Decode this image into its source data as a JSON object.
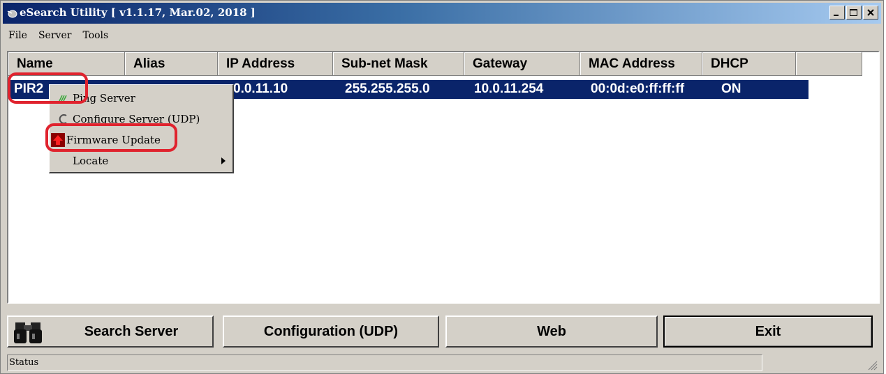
{
  "window": {
    "title": "eSearch Utility [ v1.1.17, Mar.02, 2018 ]",
    "controls": [
      "minimize-icon",
      "maximize-icon",
      "close-icon"
    ]
  },
  "menubar": {
    "items": [
      "File",
      "Server",
      "Tools"
    ]
  },
  "table": {
    "columns": [
      "Name",
      "Alias",
      "IP Address",
      "Sub-net Mask",
      "Gateway",
      "MAC Address",
      "DHCP"
    ],
    "rows": [
      {
        "name": "PIR2",
        "ip": "0.0.11.10",
        "mask": "255.255.255.0",
        "gateway": "10.0.11.254",
        "mac": "00:0d:e0:ff:ff:ff",
        "dhcp": "ON",
        "selected": true
      }
    ]
  },
  "context_menu": {
    "items": [
      {
        "label": "Ping Server",
        "icon": "ping-icon"
      },
      {
        "label": "Configure Server (UDP)",
        "icon": "configure-icon"
      },
      {
        "label": "Firmware Update",
        "icon": "firmware-update-icon"
      },
      {
        "label": "Locate",
        "icon": "submenu-arrow-icon"
      }
    ]
  },
  "buttons": {
    "search": "Search Server",
    "configuration": "Configuration (UDP)",
    "web": "Web",
    "exit": "Exit"
  },
  "status": {
    "text": "Status"
  },
  "colors": {
    "selection": "#0a246a",
    "face": "#d4d0c8",
    "annotation": "#e0232e"
  }
}
